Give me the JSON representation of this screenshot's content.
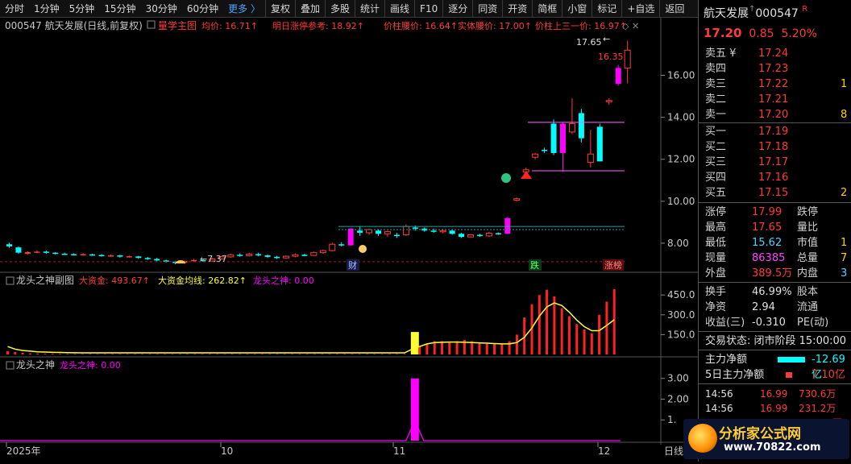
{
  "toolbar": {
    "items": [
      "分时",
      "1分钟",
      "5分钟",
      "15分钟",
      "30分钟",
      "60分钟",
      "更多 〉",
      "复权",
      "叠加",
      "多股",
      "统计",
      "画线",
      "F10",
      "逐分",
      "同资",
      "开资",
      "简框",
      "小窗",
      "标记",
      "+自选",
      "返回"
    ]
  },
  "main_header": {
    "code_name": "000547 航天发展(日线,前复权)",
    "indicator": "量学主图",
    "items": [
      "均价: 16.71↑",
      "明日涨停参考: 18.92↑",
      "价柱腰价: 16.64↑",
      "实体腰价: 17.00↑",
      "价柱上三一价: 16.97↑"
    ]
  },
  "sub1_header": {
    "name": "龙头之神副图",
    "items": [
      "大资金: 493.67↑",
      "大资金均线: 262.82↑",
      "龙头之神: 0.00"
    ]
  },
  "sub2_header": {
    "name": "龙头之神",
    "items": [
      "龙头之神: 0.00"
    ]
  },
  "annotations": {
    "high_label": "17.65",
    "high_arrow": "←",
    "last_label": "16.35",
    "low_label": "←7.37",
    "tag_cai": "财",
    "tag_die": "跌",
    "tag_zhang": "涨榜"
  },
  "x_labels": [
    "2025年",
    "10",
    "11",
    "12"
  ],
  "x_label_right": "日线",
  "main_y_ticks": [
    "16.00",
    "14.00",
    "12.00",
    "10.00",
    "8.00"
  ],
  "sub1_y_ticks": [
    "450.0",
    "300.0",
    "150.0"
  ],
  "sub2_y_ticks": [
    "3.00",
    "2.00",
    "1."
  ],
  "right_panel": {
    "name": "航天发展",
    "code": "000547",
    "tag": "R",
    "price": "17.20",
    "change": "0.85",
    "pct": "5.20%",
    "asks": [
      {
        "label": "卖五 ¥",
        "price": "17.24",
        "vol": ""
      },
      {
        "label": "卖四",
        "price": "17.23",
        "vol": ""
      },
      {
        "label": "卖三",
        "price": "17.22",
        "vol": "1"
      },
      {
        "label": "卖二",
        "price": "17.21",
        "vol": ""
      },
      {
        "label": "卖一",
        "price": "17.20",
        "vol": "8"
      }
    ],
    "bids": [
      {
        "label": "买一",
        "price": "17.19",
        "vol": ""
      },
      {
        "label": "买二",
        "price": "17.18",
        "vol": ""
      },
      {
        "label": "买三",
        "price": "17.17",
        "vol": ""
      },
      {
        "label": "买四",
        "price": "17.16",
        "vol": ""
      },
      {
        "label": "买五",
        "price": "17.15",
        "vol": "2"
      }
    ],
    "stats": [
      {
        "l1": "涨停",
        "v1": "17.99",
        "c1": "#ff3a3a",
        "l2": "跌停",
        "v2": "",
        "c2": "#3ad63a"
      },
      {
        "l1": "最高",
        "v1": "17.65",
        "c1": "#ff3a3a",
        "l2": "量比",
        "v2": "",
        "c2": "#d0d0d0"
      },
      {
        "l1": "最低",
        "v1": "15.62",
        "c1": "#4fd3ff",
        "l2": "市值",
        "v2": "1",
        "c2": "#ffd400"
      },
      {
        "l1": "现量",
        "v1": "86385",
        "c1": "#ff44ff",
        "l2": "总量",
        "v2": "7",
        "c2": "#ffd400"
      },
      {
        "l1": "外盘",
        "v1": "389.5万",
        "c1": "#ff3a3a",
        "l2": "内盘",
        "v2": "3",
        "c2": "#4fd3ff"
      }
    ],
    "stats2": [
      {
        "l1": "换手",
        "v1": "46.99%",
        "l2": "股本",
        "v2": ""
      },
      {
        "l1": "净资",
        "v1": "2.94",
        "l2": "流通",
        "v2": ""
      },
      {
        "l1": "收益(三)",
        "v1": "-0.310",
        "l2": "PE(动)",
        "v2": ""
      }
    ],
    "status": "交易状态: 闭市阶段 15:00:00",
    "flow": [
      {
        "label": "主力净额",
        "value": "-12.69亿",
        "color": "#00ffff"
      },
      {
        "label": "5日主力净额",
        "value": "7.10亿",
        "color": "#ff3a3a"
      }
    ],
    "trades": [
      {
        "time": "14:56",
        "price": "16.99",
        "vol": "730.6万"
      },
      {
        "time": "14:56",
        "price": "16.99",
        "vol": "231.2万"
      },
      {
        "time": "14:56",
        "price": "17.00",
        "vol": "1349.8万"
      }
    ]
  },
  "watermark": {
    "top": "分析家公式网",
    "bottom": "www.70822.com"
  },
  "colors": {
    "up": "#ff3a3a",
    "down": "#00ffff",
    "magenta": "#ff00ff",
    "yellow": "#ffff33",
    "text": "#c8c8c8"
  },
  "chart_data": {
    "type": "candlestick",
    "y_range": [
      7.0,
      17.9
    ],
    "candles": [
      [
        7.95,
        7.85,
        8.02,
        7.78
      ],
      [
        7.8,
        7.55,
        7.85,
        7.5
      ],
      [
        7.5,
        7.58,
        7.62,
        7.46
      ],
      [
        7.55,
        7.6,
        7.66,
        7.52
      ],
      [
        7.6,
        7.55,
        7.65,
        7.5
      ],
      [
        7.55,
        7.5,
        7.58,
        7.47
      ],
      [
        7.5,
        7.48,
        7.55,
        7.44
      ],
      [
        7.48,
        7.45,
        7.52,
        7.42
      ],
      [
        7.45,
        7.48,
        7.53,
        7.4
      ],
      [
        7.47,
        7.44,
        7.5,
        7.4
      ],
      [
        7.44,
        7.4,
        7.48,
        7.36
      ],
      [
        7.4,
        7.42,
        7.47,
        7.36
      ],
      [
        7.42,
        7.36,
        7.45,
        7.31
      ],
      [
        7.36,
        7.38,
        7.42,
        7.32
      ],
      [
        7.37,
        7.3,
        7.4,
        7.26
      ],
      [
        7.3,
        7.25,
        7.35,
        7.2
      ],
      [
        7.25,
        7.18,
        7.3,
        7.14
      ],
      [
        7.18,
        7.12,
        7.22,
        7.08
      ],
      [
        7.12,
        7.06,
        7.16,
        7.0
      ],
      [
        7.06,
        7.15,
        7.18,
        7.02
      ],
      [
        7.14,
        7.2,
        7.25,
        7.1
      ],
      [
        7.2,
        7.15,
        7.26,
        7.12
      ],
      [
        7.15,
        7.25,
        7.3,
        7.12
      ],
      [
        7.25,
        7.35,
        7.4,
        7.22
      ],
      [
        7.35,
        7.45,
        7.5,
        7.3
      ],
      [
        7.45,
        7.4,
        7.52,
        7.36
      ],
      [
        7.4,
        7.48,
        7.54,
        7.37
      ],
      [
        7.48,
        7.42,
        7.55,
        7.38
      ],
      [
        7.42,
        7.35,
        7.46,
        7.3
      ],
      [
        7.35,
        7.3,
        7.4,
        7.25
      ],
      [
        7.3,
        7.38,
        7.42,
        7.27
      ],
      [
        7.38,
        7.45,
        7.5,
        7.33
      ],
      [
        7.45,
        7.42,
        7.5,
        7.38
      ],
      [
        7.42,
        7.55,
        7.6,
        7.4
      ],
      [
        7.55,
        7.65,
        7.7,
        7.5
      ],
      [
        7.65,
        7.95,
        8.02,
        7.6
      ],
      [
        7.95,
        7.9,
        8.05,
        7.85
      ],
      [
        7.9,
        8.7,
        8.72,
        7.88
      ],
      [
        8.6,
        8.5,
        8.8,
        8.35
      ],
      [
        8.5,
        8.65,
        8.7,
        8.4
      ],
      [
        8.6,
        8.45,
        8.66,
        8.35
      ],
      [
        8.45,
        8.55,
        8.6,
        8.3
      ],
      [
        8.4,
        8.35,
        8.5,
        8.25
      ],
      [
        8.4,
        8.8,
        8.9,
        8.35
      ],
      [
        8.75,
        8.7,
        8.85,
        8.6
      ],
      [
        8.7,
        8.6,
        8.75,
        8.55
      ],
      [
        8.6,
        8.55,
        8.7,
        8.5
      ],
      [
        8.55,
        8.6,
        8.68,
        8.48
      ],
      [
        8.6,
        8.45,
        8.64,
        8.4
      ],
      [
        8.45,
        8.3,
        8.5,
        8.25
      ],
      [
        8.3,
        8.4,
        8.45,
        8.28
      ],
      [
        8.4,
        8.35,
        8.45,
        8.3
      ],
      [
        8.35,
        8.48,
        8.55,
        8.3
      ],
      [
        8.48,
        8.45,
        8.52,
        8.4
      ],
      [
        8.45,
        9.2,
        9.25,
        8.44
      ],
      [
        10.05,
        10.12,
        10.18,
        10.0
      ],
      [
        11.4,
        11.5,
        11.6,
        11.2
      ],
      [
        12.1,
        12.25,
        12.3,
        12.0
      ],
      [
        12.45,
        12.4,
        12.55,
        12.3
      ],
      [
        13.7,
        12.3,
        13.9,
        12.2
      ],
      [
        12.3,
        13.7,
        13.75,
        11.4
      ],
      [
        13.3,
        13.7,
        14.9,
        13.2
      ],
      [
        14.2,
        13.0,
        14.4,
        12.8
      ],
      [
        11.85,
        12.25,
        13.4,
        11.6
      ],
      [
        13.55,
        11.9,
        13.7,
        11.9
      ],
      [
        14.75,
        14.8,
        14.9,
        14.6
      ],
      [
        15.6,
        16.35,
        16.5,
        15.5
      ],
      [
        16.35,
        17.2,
        17.65,
        15.62
      ]
    ],
    "ma_line": [
      8.55,
      8.6,
      8.65,
      8.65,
      8.7,
      8.7,
      8.7,
      8.7,
      8.72,
      8.72,
      8.72,
      8.72
    ],
    "sub1_bars": [
      25,
      18,
      12,
      8,
      6,
      5,
      5,
      4,
      4,
      4,
      4,
      4,
      4,
      4,
      4,
      4,
      4,
      4,
      4,
      4,
      4,
      4,
      4,
      4,
      4,
      4,
      4,
      4,
      4,
      4,
      4,
      4,
      4,
      4,
      4,
      4,
      4,
      4,
      4,
      4,
      4,
      4,
      4,
      4,
      4,
      4,
      4,
      4,
      4,
      4,
      4,
      4,
      4,
      4,
      170,
      60,
      80,
      100,
      100,
      90,
      100,
      110,
      100,
      90,
      80,
      80,
      80,
      100,
      150,
      280,
      380,
      450,
      490,
      440,
      350,
      290,
      230,
      190,
      160,
      300,
      400,
      494
    ],
    "sub1_line": [
      60,
      40,
      30,
      25,
      20,
      18,
      16,
      15,
      14,
      13,
      12,
      12,
      12,
      12,
      12,
      12,
      12,
      12,
      12,
      12,
      12,
      12,
      12,
      12,
      12,
      12,
      12,
      12,
      12,
      12,
      12,
      12,
      12,
      12,
      12,
      12,
      12,
      12,
      12,
      12,
      12,
      12,
      12,
      12,
      12,
      12,
      12,
      12,
      12,
      12,
      12,
      12,
      12,
      12,
      40,
      60,
      80,
      90,
      92,
      94,
      94,
      92,
      90,
      88,
      85,
      82,
      80,
      80,
      90,
      130,
      200,
      290,
      360,
      390,
      370,
      320,
      260,
      210,
      180,
      180,
      220,
      263
    ],
    "sub2_peak": 3.0
  }
}
